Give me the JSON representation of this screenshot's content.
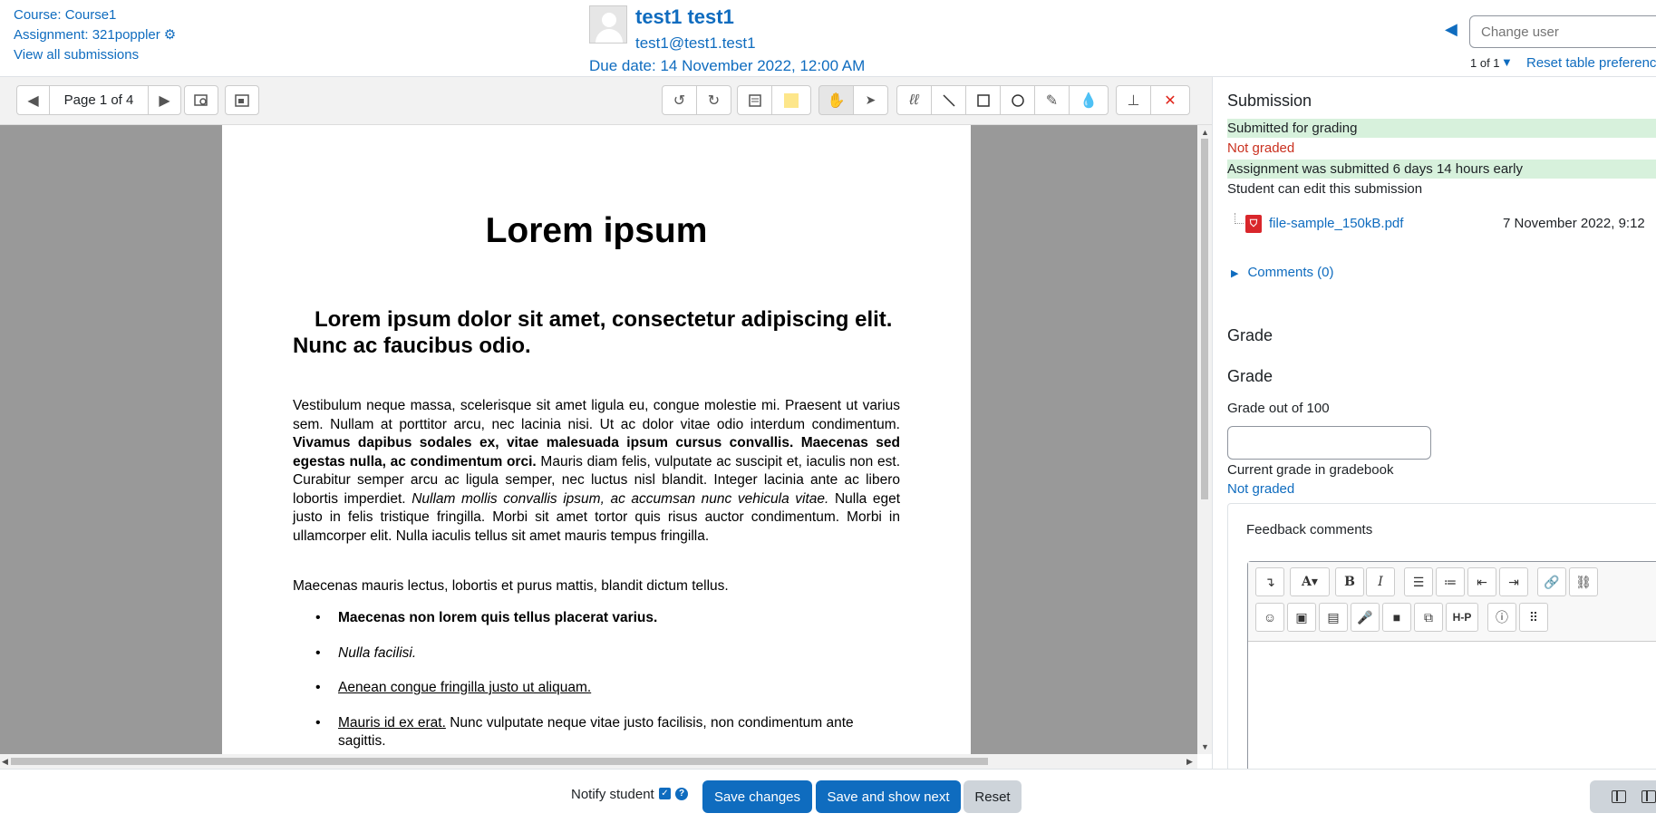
{
  "header": {
    "course": "Course: Course1",
    "assignment": "Assignment: 321poppler",
    "view_all": "View all submissions",
    "user_name": "test1 test1",
    "user_email": "test1@test1.test1",
    "due_date": "Due date: 14 November 2022, 12:00 AM",
    "change_user_placeholder": "Change user",
    "pager": "1 of 1",
    "reset_pref": "Reset table preferences"
  },
  "toolbar": {
    "page_label": "Page 1 of 4"
  },
  "document": {
    "title": "Lorem ipsum",
    "subtitle": "Lorem ipsum dolor sit amet, consectetur adipiscing elit. Nunc ac faucibus odio.",
    "para_1": "Vestibulum neque massa, scelerisque sit amet ligula eu, congue molestie mi. Praesent ut varius sem. Nullam at porttitor arcu, nec lacinia nisi. Ut ac dolor vitae odio interdum condimentum.",
    "para_bold": "Vivamus dapibus sodales ex, vitae malesuada ipsum cursus convallis. Maecenas sed egestas nulla, ac condimentum orci.",
    "para_2": "Mauris diam felis, vulputate ac suscipit et, iaculis non est. Curabitur semper arcu ac ligula semper, nec luctus nisl blandit. Integer lacinia ante ac libero lobortis imperdiet.",
    "para_italic": "Nullam mollis convallis ipsum, ac accumsan nunc vehicula vitae.",
    "para_3": "Nulla eget justo in felis tristique fringilla. Morbi sit amet tortor quis risus auctor condimentum. Morbi in ullamcorper elit. Nulla iaculis tellus sit amet mauris tempus fringilla.",
    "line": "Maecenas mauris lectus, lobortis et purus mattis, blandit dictum tellus.",
    "list_1": "Maecenas non lorem quis tellus placerat varius.",
    "list_2": "Nulla facilisi.",
    "list_3": "Aenean congue fringilla justo ut aliquam.",
    "list_4a": "Mauris id ex erat.",
    "list_4b": " Nunc vulputate neque vitae justo facilisis, non condimentum ante sagittis."
  },
  "panel": {
    "submission_heading": "Submission",
    "status_1": "Submitted for grading",
    "status_2": "Not graded",
    "status_3": "Assignment was submitted 6 days 14 hours early",
    "status_4": "Student can edit this submission",
    "file_name": "file-sample_150kB.pdf",
    "file_date": "7 November 2022, 9:12",
    "comments": "Comments (0)",
    "grade_heading_1": "Grade",
    "grade_heading_2": "Grade",
    "grade_out_of": "Grade out of 100",
    "current_grade_label": "Current grade in gradebook",
    "current_grade_value": "Not graded",
    "feedback_title": "Feedback comments"
  },
  "footer": {
    "notify": "Notify student",
    "save": "Save changes",
    "save_next": "Save and show next",
    "reset": "Reset"
  },
  "icons": {
    "prev": "◀",
    "next": "▶",
    "undo": "↺",
    "redo": "↻"
  },
  "colors": {
    "primary": "#0f6cbf",
    "success_bg": "#d7f1dc",
    "danger": "#ca3120"
  }
}
